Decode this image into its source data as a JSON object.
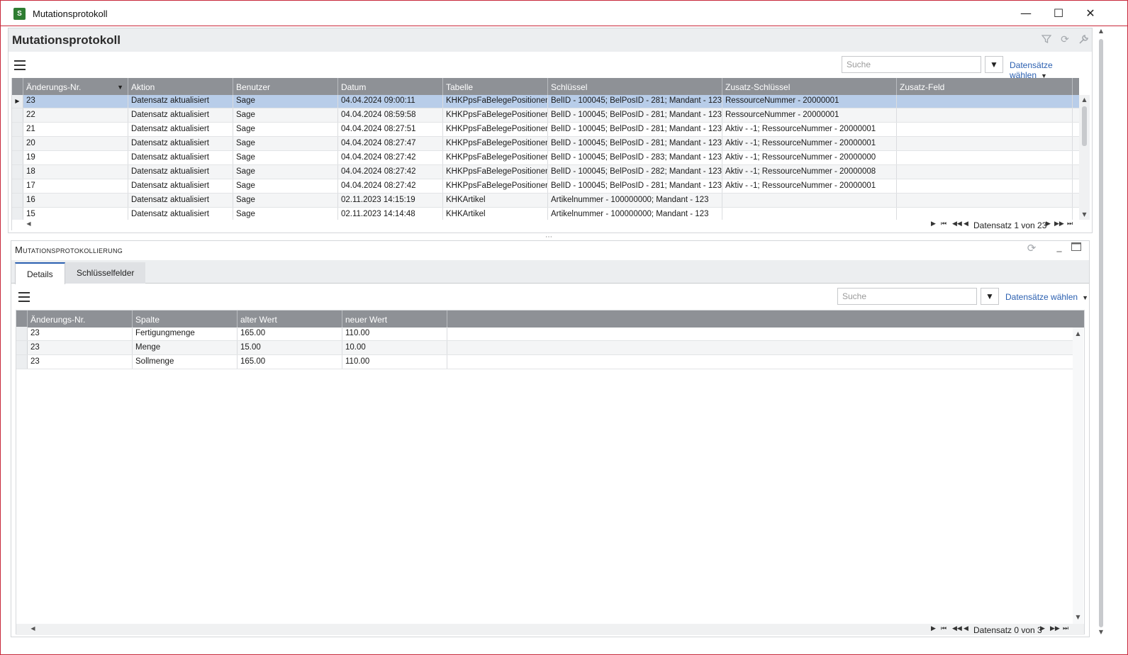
{
  "window": {
    "title": "Mutationsprotokoll",
    "minimize": "—",
    "maximize": "☐",
    "close": "✕"
  },
  "top_panel": {
    "title": "Mutationsprotokoll",
    "search_placeholder": "Suche",
    "filter_glyph": "▼",
    "choose_label": "Datensätze wählen",
    "columns": [
      "Änderungs-Nr.",
      "Aktion",
      "Benutzer",
      "Datum",
      "Tabelle",
      "Schlüssel",
      "Zusatz-Schlüssel",
      "Zusatz-Feld"
    ],
    "rows": [
      [
        "23",
        "Datensatz aktualisiert",
        "Sage",
        "04.04.2024 09:00:11",
        "KHKPpsFaBelegePositionen",
        "BelID - 100045; BelPosID - 281; Mandant - 123",
        "RessourceNummer - 20000001",
        ""
      ],
      [
        "22",
        "Datensatz aktualisiert",
        "Sage",
        "04.04.2024 08:59:58",
        "KHKPpsFaBelegePositionen",
        "BelID - 100045; BelPosID - 281; Mandant - 123",
        "RessourceNummer - 20000001",
        ""
      ],
      [
        "21",
        "Datensatz aktualisiert",
        "Sage",
        "04.04.2024 08:27:51",
        "KHKPpsFaBelegePositionen",
        "BelID - 100045; BelPosID - 281; Mandant - 123",
        "Aktiv - -1; RessourceNummer - 20000001",
        ""
      ],
      [
        "20",
        "Datensatz aktualisiert",
        "Sage",
        "04.04.2024 08:27:47",
        "KHKPpsFaBelegePositionen",
        "BelID - 100045; BelPosID - 281; Mandant - 123",
        "Aktiv - -1; RessourceNummer - 20000001",
        ""
      ],
      [
        "19",
        "Datensatz aktualisiert",
        "Sage",
        "04.04.2024 08:27:42",
        "KHKPpsFaBelegePositionen",
        "BelID - 100045; BelPosID - 283; Mandant - 123",
        "Aktiv - -1; RessourceNummer - 20000000",
        ""
      ],
      [
        "18",
        "Datensatz aktualisiert",
        "Sage",
        "04.04.2024 08:27:42",
        "KHKPpsFaBelegePositionen",
        "BelID - 100045; BelPosID - 282; Mandant - 123",
        "Aktiv - -1; RessourceNummer - 20000008",
        ""
      ],
      [
        "17",
        "Datensatz aktualisiert",
        "Sage",
        "04.04.2024 08:27:42",
        "KHKPpsFaBelegePositionen",
        "BelID - 100045; BelPosID - 281; Mandant - 123",
        "Aktiv - -1; RessourceNummer - 20000001",
        ""
      ],
      [
        "16",
        "Datensatz aktualisiert",
        "Sage",
        "02.11.2023 14:15:19",
        "KHKArtikel",
        "Artikelnummer - 100000000; Mandant - 123",
        "",
        ""
      ],
      [
        "15",
        "Datensatz aktualisiert",
        "Sage",
        "02.11.2023 14:14:48",
        "KHKArtikel",
        "Artikelnummer - 100000000; Mandant - 123",
        "",
        ""
      ]
    ],
    "nav_text": "Datensatz 1 von 23"
  },
  "bottom_panel": {
    "title": "Mutationsprotokollierung",
    "tabs": [
      "Details",
      "Schlüsselfelder"
    ],
    "search_placeholder": "Suche",
    "filter_glyph": "▼",
    "choose_label": "Datensätze wählen",
    "columns": [
      "Änderungs-Nr.",
      "Spalte",
      "alter Wert",
      "neuer Wert"
    ],
    "rows": [
      [
        "23",
        "Fertigungmenge",
        "165.00",
        "110.00"
      ],
      [
        "23",
        "Menge",
        "15.00",
        "10.00"
      ],
      [
        "23",
        "Sollmenge",
        "165.00",
        "110.00"
      ]
    ],
    "nav_text": "Datensatz 0 von 3"
  },
  "colors": {
    "accent": "#2a5fb0",
    "window_border": "#c8283a",
    "header_bg": "#8e9196",
    "selected_row": "#b8cde9"
  }
}
